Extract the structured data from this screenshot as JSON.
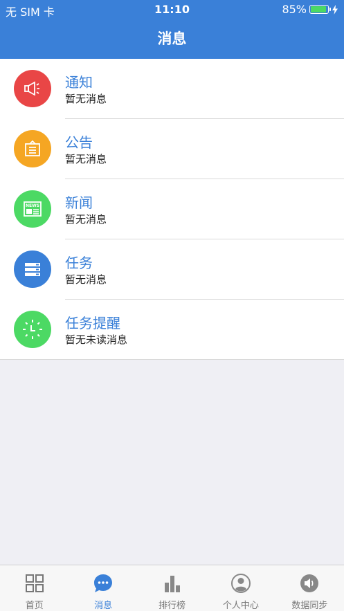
{
  "status_bar": {
    "carrier": "无 SIM 卡",
    "time": "11:10",
    "battery": "85%",
    "battery_level": 0.85
  },
  "nav": {
    "title": "消息"
  },
  "messages": [
    {
      "title": "通知",
      "subtitle": "暂无消息",
      "icon": "megaphone-icon",
      "color": "#e94646"
    },
    {
      "title": "公告",
      "subtitle": "暂无消息",
      "icon": "notice-board-icon",
      "color": "#f5a623"
    },
    {
      "title": "新闻",
      "subtitle": "暂无消息",
      "icon": "newspaper-icon",
      "color": "#4cd964"
    },
    {
      "title": "任务",
      "subtitle": "暂无消息",
      "icon": "task-list-icon",
      "color": "#3a80d8"
    },
    {
      "title": "任务提醒",
      "subtitle": "暂无未读消息",
      "icon": "clock-icon",
      "color": "#4cd964"
    }
  ],
  "tabbar": {
    "active_color": "#3a80d8",
    "items": [
      {
        "label": "首页",
        "icon": "grid-icon"
      },
      {
        "label": "消息",
        "icon": "chat-bubble-icon",
        "active": true
      },
      {
        "label": "排行榜",
        "icon": "bar-chart-icon"
      },
      {
        "label": "个人中心",
        "icon": "person-icon"
      },
      {
        "label": "数据同步",
        "icon": "speaker-icon"
      }
    ]
  }
}
